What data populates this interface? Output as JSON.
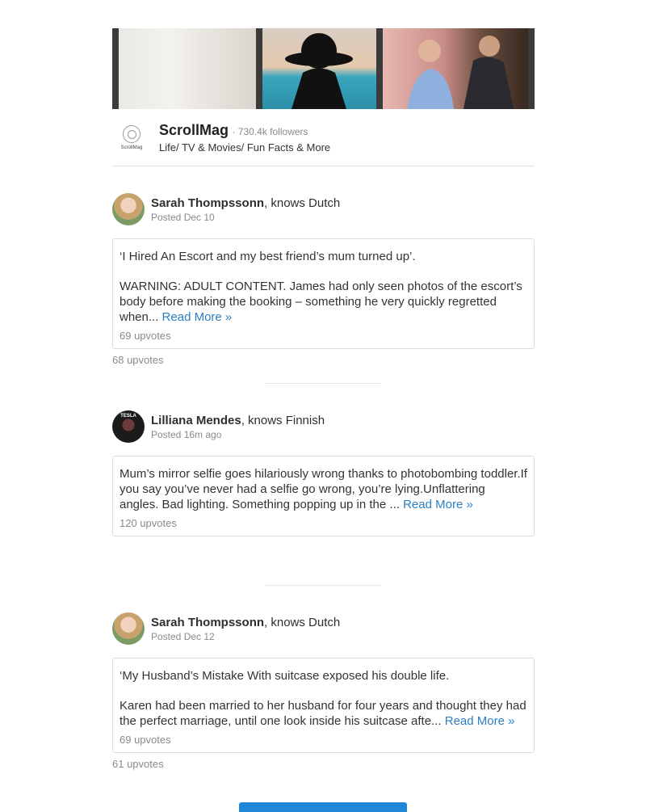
{
  "publication": {
    "name": "ScrollMag",
    "followers": "· 730.4k followers",
    "subtitle": "Life/ TV & Movies/ Fun Facts & More",
    "logo_text": "ScrollMag",
    "logo_icon": "scrollmag-logo-icon"
  },
  "posts": [
    {
      "author": "Sarah Thompssonn",
      "credential": ", knows Dutch",
      "date": "Posted Dec 10",
      "title": "‘I Hired An Escort and my best friend’s mum turned up’.",
      "body": "WARNING: ADULT CONTENT. James had only seen photos of the escort’s body before making the booking – something he very quickly regretted when...",
      "read_more": "Read More »",
      "card_upvotes": "69 upvotes",
      "upvotes": "68 upvotes"
    },
    {
      "author": "Lilliana Mendes",
      "credential": ", knows Finnish",
      "date": "Posted 16m ago",
      "avatar_text": "TESLA",
      "body": "Mum’s mirror selfie goes hilariously wrong thanks to photobombing toddler.If you say you’ve never had a selfie go wrong, you’re lying.Unflattering angles. Bad lighting. Something popping up in the ...",
      "read_more": "Read More »",
      "card_upvotes": "120 upvotes"
    },
    {
      "author": "Sarah Thompssonn",
      "credential": ", knows Dutch",
      "date": "Posted Dec 12",
      "title": "‘My Husband’s Mistake With suitcase exposed his double life.",
      "body": "Karen had been married to her husband for four years and thought they had the perfect marriage, until one look inside his suitcase afte...",
      "read_more": "Read More »",
      "card_upvotes": "69 upvotes",
      "upvotes": "61 upvotes"
    }
  ],
  "colors": {
    "link": "#2b7fc4",
    "button": "#1f87d6"
  }
}
